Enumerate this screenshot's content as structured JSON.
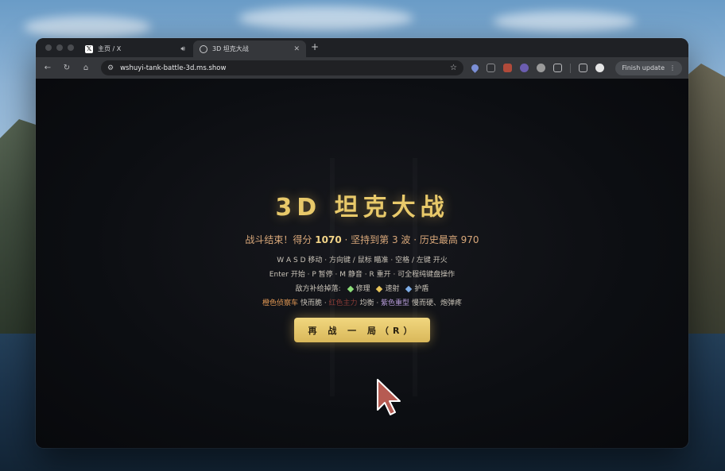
{
  "tabs": [
    {
      "label": "主页 / X",
      "active": false,
      "icon": "x-logo-icon"
    },
    {
      "label": "3D 坦克大战",
      "active": true,
      "icon": "globe-icon"
    }
  ],
  "toolbar": {
    "url": "wshuyi-tank-battle-3d.ms.show",
    "finish_update": "Finish update"
  },
  "game": {
    "title": "3D 坦克大战",
    "summary_prefix": "战斗结束！得分",
    "score": "1070",
    "summary_mid": "· 坚持到第 3 波 · 历史最高 970",
    "controls_1": "W A S D 移动 · 方向键 / 鼠标 瞄准 · 空格 / 左键 开火",
    "controls_2": "Enter 开始 · P 暂停 · M 静音 · R 重开 · 可全程纯键盘操作",
    "drops_label": "敌方补给掉落:",
    "drop_repair": "修理",
    "drop_rapid": "速射",
    "drop_shield": "护盾",
    "enemy_orange": "橙色侦察车",
    "enemy_orange_desc": "快而脆",
    "enemy_red": "红色主力",
    "enemy_red_desc": "均衡",
    "enemy_purple": "紫色重型",
    "enemy_purple_desc": "慢而硬、炮弹疼",
    "play_again": "再 战 一 局（R）"
  },
  "colors": {
    "accent_gold": "#e8c96a",
    "button_gold": "#d9b85a",
    "page_bg": "#0c0e12"
  }
}
